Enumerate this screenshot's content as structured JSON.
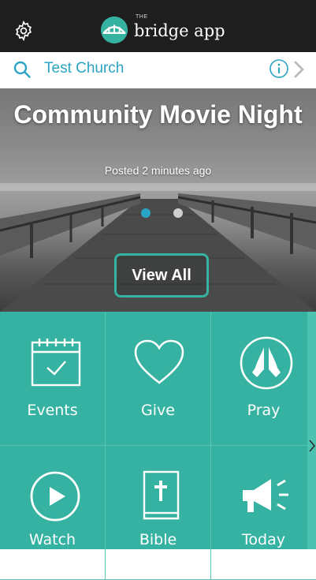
{
  "header": {
    "app_name": "bridge app",
    "app_name_prefix": "THE",
    "settings_icon": "gear-icon",
    "logo_icon": "bridge-logo-icon"
  },
  "search": {
    "church_name": "Test Church",
    "search_icon": "search-icon",
    "info_icon": "info-icon",
    "next_icon": "chevron-right-icon"
  },
  "hero": {
    "title": "Community Movie Night",
    "subtitle": "Posted 2 minutes ago",
    "button_label": "View All",
    "carousel": {
      "pages": 2,
      "active_index": 0
    },
    "colors": {
      "dot_active": "#2aa3c4",
      "dot_inactive": "#d0d0d0",
      "button_border": "#35b2a1"
    }
  },
  "grid": {
    "accent": "#35b2a1",
    "tiles": [
      {
        "label": "Events",
        "icon": "calendar-check-icon"
      },
      {
        "label": "Give",
        "icon": "heart-icon"
      },
      {
        "label": "Pray",
        "icon": "praying-hands-icon"
      },
      {
        "label": "Watch",
        "icon": "play-circle-icon"
      },
      {
        "label": "Bible",
        "icon": "bible-icon"
      },
      {
        "label": "Today",
        "icon": "megaphone-icon"
      }
    ]
  }
}
